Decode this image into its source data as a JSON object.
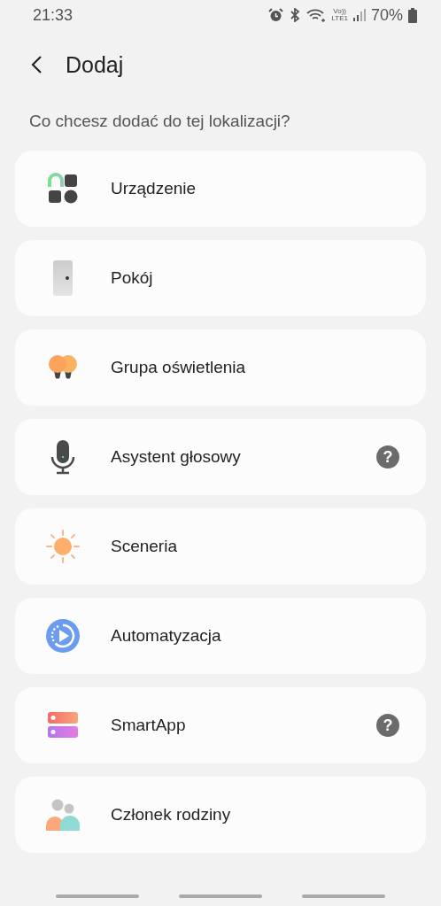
{
  "status_bar": {
    "time": "21:33",
    "volte": "Vo))",
    "network": "LTE1",
    "battery": "70%"
  },
  "header": {
    "title": "Dodaj"
  },
  "prompt": "Co chcesz dodać do tej lokalizacji?",
  "items": [
    {
      "kind": "device",
      "label": "Urządzenie"
    },
    {
      "kind": "room",
      "label": "Pokój"
    },
    {
      "kind": "lights",
      "label": "Grupa oświetlenia"
    },
    {
      "kind": "voice",
      "label": "Asystent głosowy",
      "help": "?"
    },
    {
      "kind": "scene",
      "label": "Sceneria"
    },
    {
      "kind": "automation",
      "label": "Automatyzacja"
    },
    {
      "kind": "smartapp",
      "label": "SmartApp",
      "help": "?"
    },
    {
      "kind": "member",
      "label": "Członek rodziny"
    }
  ]
}
